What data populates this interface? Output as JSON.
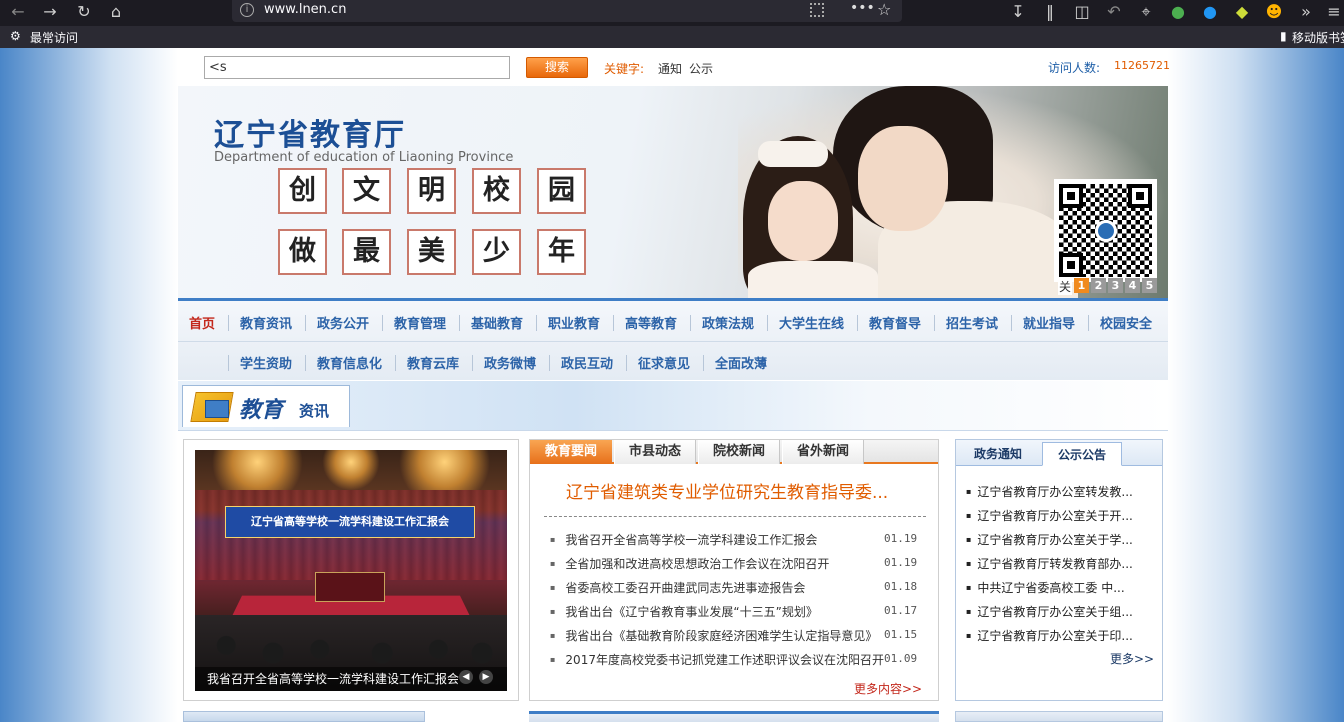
{
  "browser": {
    "url": "www.lnen.cn",
    "bookmarks": [
      "最常访问",
      "移动版书签"
    ],
    "colors": {
      "toolbar": "#1c1b22",
      "urlbar": "#2b2a33"
    }
  },
  "search": {
    "input_value": "<s",
    "button_label": "搜索",
    "keyword_label": "关键字:",
    "keywords": [
      "通知",
      "公示"
    ],
    "visit_label": "访问人数:",
    "visit_count": "11265721"
  },
  "banner": {
    "title": "辽宁省教育厅",
    "subtitle": "Department of education of Liaoning Province",
    "row1": [
      "创",
      "文",
      "明",
      "校",
      "园"
    ],
    "row2": [
      "做",
      "最",
      "美",
      "少",
      "年"
    ],
    "close_label": "关",
    "slides": [
      "1",
      "2",
      "3",
      "4",
      "5"
    ],
    "active_slide": "1"
  },
  "nav": {
    "row1": [
      "首页",
      "教育资讯",
      "政务公开",
      "教育管理",
      "基础教育",
      "职业教育",
      "高等教育",
      "政策法规",
      "大学生在线",
      "教育督导",
      "招生考试",
      "就业指导",
      "校园安全"
    ],
    "row2": [
      "学生资助",
      "教育信息化",
      "教育云库",
      "政务微博",
      "政民互动",
      "征求意见",
      "全面改薄"
    ],
    "colors": {
      "link": "#2c63a8",
      "active": "#c3271b",
      "accent": "#3f7ec6"
    }
  },
  "section": {
    "title_a": "教育",
    "title_b": "资讯"
  },
  "photo": {
    "banner_text": "辽宁省高等学校一流学科建设工作汇报会",
    "caption": "我省召开全省高等学校一流学科建设工作汇报会"
  },
  "news": {
    "tabs": [
      "教育要闻",
      "市县动态",
      "院校新闻",
      "省外新闻"
    ],
    "active_tab": "教育要闻",
    "headline": "辽宁省建筑类专业学位研究生教育指导委...",
    "items": [
      {
        "title": "我省召开全省高等学校一流学科建设工作汇报会",
        "date": "01.19"
      },
      {
        "title": "全省加强和改进高校思想政治工作会议在沈阳召开",
        "date": "01.19"
      },
      {
        "title": "省委高校工委召开曲建武同志先进事迹报告会",
        "date": "01.18"
      },
      {
        "title": "我省出台《辽宁省教育事业发展“十三五”规划》",
        "date": "01.17"
      },
      {
        "title": "我省出台《基础教育阶段家庭经济困难学生认定指导意见》",
        "date": "01.15"
      },
      {
        "title": "2017年度高校党委书记抓党建工作述职评议会议在沈阳召开",
        "date": "01.09"
      }
    ],
    "more_label": "更多内容>>"
  },
  "notices": {
    "tabs": [
      "政务通知",
      "公示公告"
    ],
    "active_tab": "公示公告",
    "items": [
      "辽宁省教育厅办公室转发教...",
      "辽宁省教育厅办公室关于开...",
      "辽宁省教育厅办公室关于学...",
      "辽宁省教育厅转发教育部办...",
      "中共辽宁省委高校工委 中...",
      "辽宁省教育厅办公室关于组...",
      "辽宁省教育厅办公室关于印..."
    ],
    "more_label": "更多>>"
  }
}
